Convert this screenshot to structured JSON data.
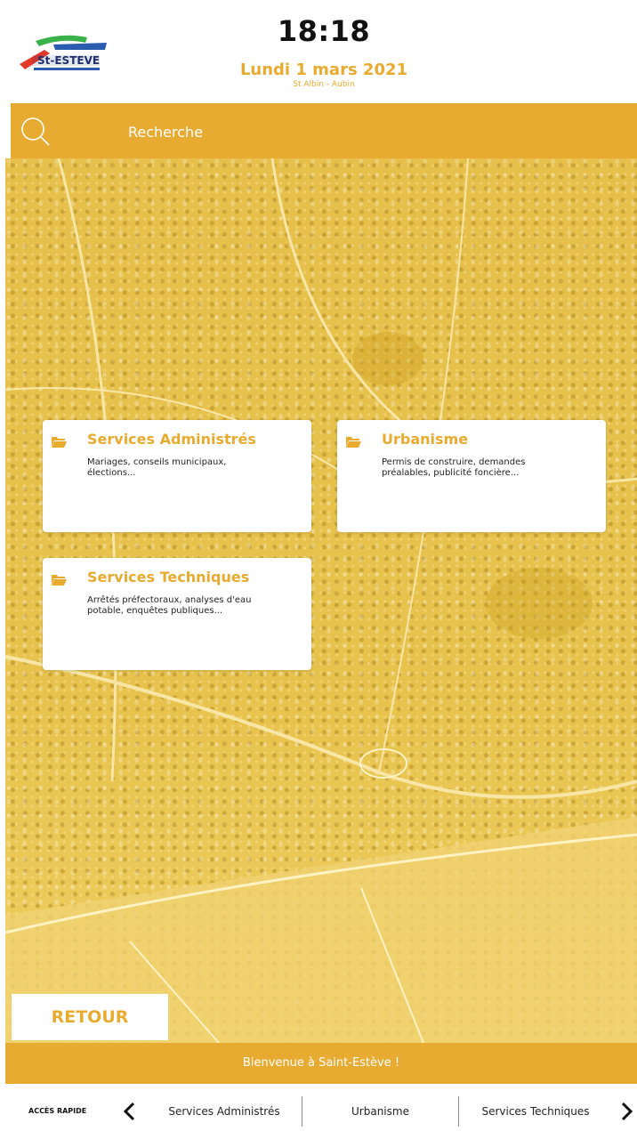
{
  "header": {
    "logo_text": "St-ESTEVE",
    "time": "18:18",
    "date": "Lundi 1 mars 2021",
    "place": "St Albin - Aubin"
  },
  "search": {
    "placeholder": "Recherche",
    "icon": "search-icon"
  },
  "cards": [
    {
      "title": "Services Administrés",
      "description": "Mariages, conseils municipaux, élections...",
      "icon": "folder-icon"
    },
    {
      "title": "Urbanisme",
      "description": "Permis de construire, demandes préalables, publicité foncière...",
      "icon": "folder-icon"
    },
    {
      "title": "Services Techniques",
      "description": "Arrêtés préfectoraux, analyses d'eau potable, enquêtes publiques...",
      "icon": "folder-icon"
    }
  ],
  "retour_label": "RETOUR",
  "welcome": "Bienvenue à Saint-Estève !",
  "quick_access": {
    "label": "ACCÈS RAPIDE",
    "items": [
      "Services Administrés",
      "Urbanisme",
      "Services Techniques"
    ],
    "prev_icon": "chevron-left-icon",
    "next_icon": "chevron-right-icon"
  },
  "colors": {
    "accent": "#e8ab32",
    "background_tint": "#e6c04a",
    "card_bg": "#ffffff",
    "text": "#222222"
  }
}
